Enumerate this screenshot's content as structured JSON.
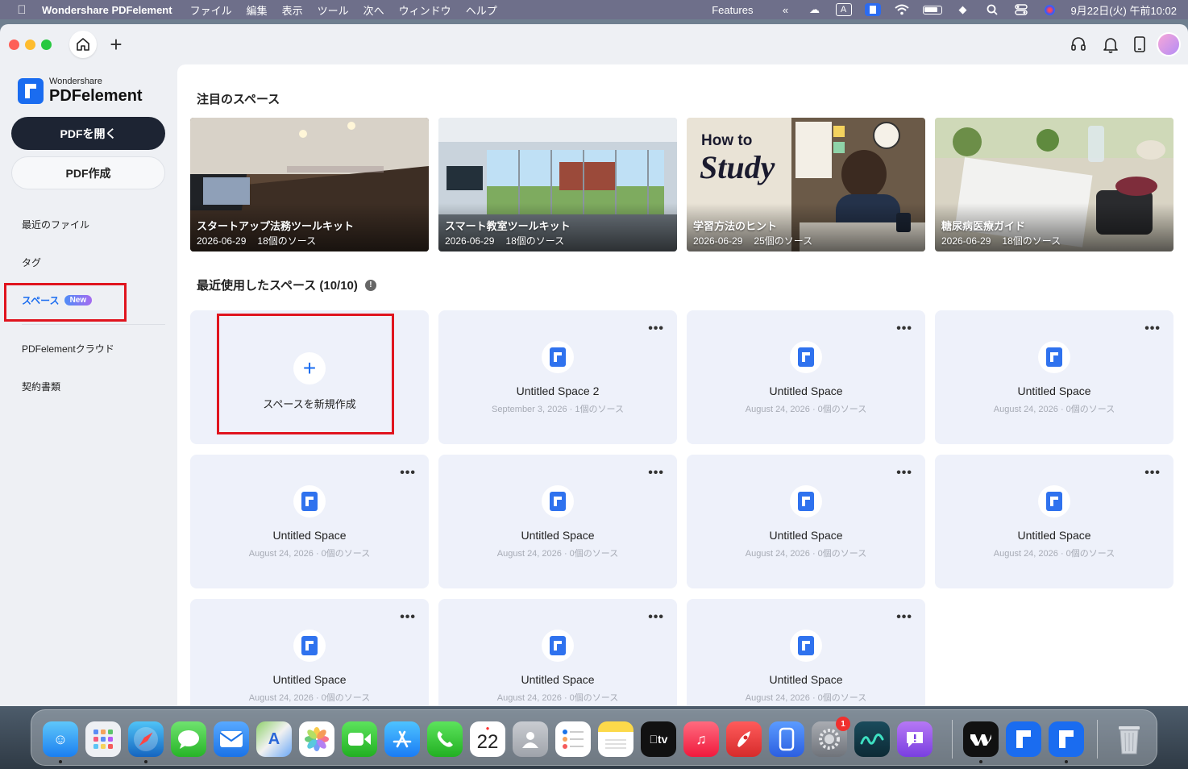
{
  "menubar": {
    "app_name": "Wondershare PDFelement",
    "items": [
      "ファイル",
      "編集",
      "表示",
      "ツール",
      "次へ",
      "ウィンドウ",
      "ヘルプ"
    ],
    "features": "Features",
    "datetime": "9月22日(火) 午前10:02"
  },
  "sidebar": {
    "logo_small": "Wondershare",
    "logo_big": "PDFelement",
    "open_button": "PDFを開く",
    "create_button": "PDF作成",
    "nav": {
      "recent": "最近のファイル",
      "tags": "タグ",
      "spaces": "スペース",
      "spaces_badge": "New",
      "cloud": "PDFelementクラウド",
      "contracts": "契約書類"
    }
  },
  "main": {
    "featured_title": "注目のスペース",
    "recent_title": "最近使用したスペース (10/10)",
    "featured": [
      {
        "title": "スタートアップ法務ツールキット",
        "date": "2026-06-29",
        "sources": "18個のソース"
      },
      {
        "title": "スマート教室ツールキット",
        "date": "2026-06-29",
        "sources": "18個のソース"
      },
      {
        "title": "学習方法のヒント",
        "date": "2026-06-29",
        "sources": "25個のソース"
      },
      {
        "title": "糖尿病医療ガイド",
        "date": "2026-06-29",
        "sources": "18個のソース"
      }
    ],
    "featured_art": {
      "how_to": "How to",
      "study": "Study"
    },
    "create_label": "スペースを新規作成",
    "spaces": [
      {
        "name": "Untitled Space 2",
        "meta": "September 3, 2026 · 1個のソース"
      },
      {
        "name": "Untitled Space",
        "meta": "August 24, 2026 · 0個のソース"
      },
      {
        "name": "Untitled Space",
        "meta": "August 24, 2026 · 0個のソース"
      },
      {
        "name": "Untitled Space",
        "meta": "August 24, 2026 · 0個のソース"
      },
      {
        "name": "Untitled Space",
        "meta": "August 24, 2026 · 0個のソース"
      },
      {
        "name": "Untitled Space",
        "meta": "August 24, 2026 · 0個のソース"
      },
      {
        "name": "Untitled Space",
        "meta": "August 24, 2026 · 0個のソース"
      },
      {
        "name": "Untitled Space",
        "meta": "August 24, 2026 · 0個のソース"
      },
      {
        "name": "Untitled Space",
        "meta": "August 24, 2026 · 0個のソース"
      },
      {
        "name": "Untitled Space",
        "meta": "August 24, 2026 · 0個のソース"
      }
    ],
    "more_label": "•••"
  },
  "dock": {
    "calendar_day": "22",
    "settings_badge": "1",
    "tv_label": "tv"
  },
  "colors": {
    "accent": "#1a6cf0",
    "highlight": "#e0141e",
    "card_bg": "#eef1fa",
    "dark_button": "#1d2433"
  }
}
